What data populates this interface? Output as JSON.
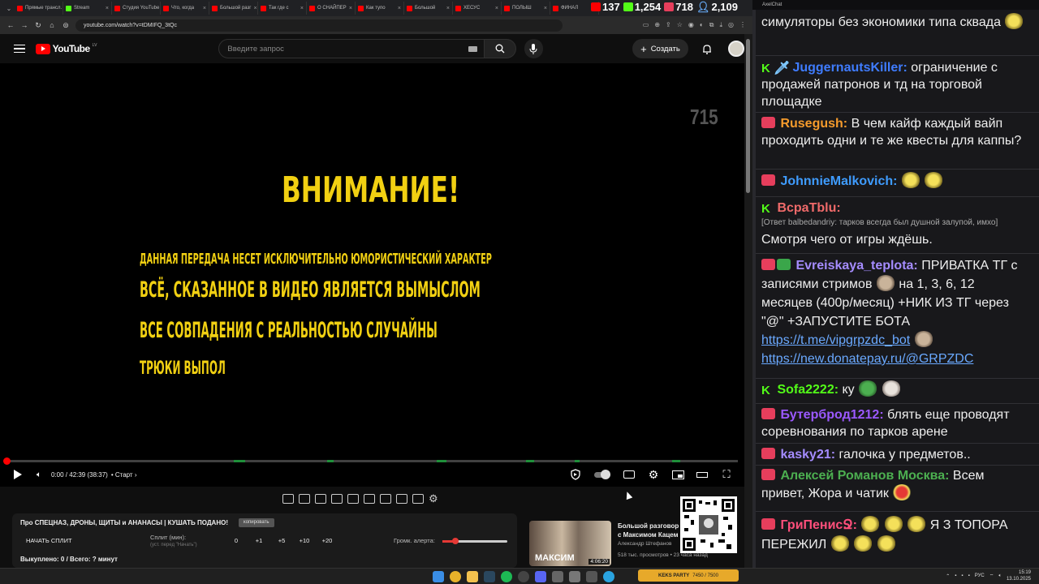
{
  "browser": {
    "tabs": [
      {
        "label": "Прямые трансл.",
        "color": "#ff0000"
      },
      {
        "label": "Stream",
        "color": "#53fc18"
      },
      {
        "label": "Студия YouTube",
        "color": "#ff0000"
      },
      {
        "label": "Что, когда",
        "color": "#ff0000"
      },
      {
        "label": "Большой разг",
        "color": "#ff0000"
      },
      {
        "label": "Так где с",
        "color": "#ff0000"
      },
      {
        "label": "О СНАЙПЕР",
        "color": "#ff0000"
      },
      {
        "label": "Как тупо",
        "color": "#ff0000"
      },
      {
        "label": "Большой",
        "color": "#ff0000"
      },
      {
        "label": "ХЕСУС",
        "color": "#ff0000"
      },
      {
        "label": "ПОЛЫШ",
        "color": "#ff0000"
      },
      {
        "label": "ФИНАЛ",
        "color": "#ff0000"
      }
    ],
    "url": "youtube.com/watch?v=tDMIFQ_3tQc"
  },
  "youtube": {
    "logo_text": "YouTube",
    "logo_country": "LV",
    "search_placeholder": "Введите запрос",
    "create_label": "Создать"
  },
  "video": {
    "counter": "715",
    "title_text": "ВНИМАНИЕ!",
    "line1": "ДАННАЯ ПЕРЕДАЧА НЕСЕТ ИСКЛЮЧИТЕЛЬНО ЮМОРИСТИЧЕСКИЙ ХАРАКТЕР",
    "line2": "ВСЁ, СКАЗАННОЕ В ВИДЕО ЯВЛЯЕТСЯ ВЫМЫСЛОМ",
    "line3": "ВСЕ СОВПАДЕНИЯ С РЕАЛЬНОСТЬЮ СЛУЧАЙНЫ",
    "line4": "ТРЮКИ ВЫПОЛ",
    "time": "0:00 / 42:39 (38:37)",
    "chapter": "• Старт ›",
    "progress": 0.0
  },
  "panel": {
    "video_title": "Про СПЕЦНАЗ, ДРОНЫ, ЩИТЫ и АНАНАСЫ | КУШАТЬ ПОДАНО!",
    "copy_label": "копировать",
    "split_button": "НАЧАТЬ СПЛИТ",
    "split_label": "Сплит (мин):",
    "split_hint": "(уст. перед \"Начать\")",
    "split_values": [
      "0",
      "+1",
      "+5",
      "+10",
      "+20"
    ],
    "alert_label": "Громк. алерта:",
    "alert_volume": 0.2,
    "bought": "Выкуплено: 0 / Всего: ? минут"
  },
  "recommendation": {
    "title": "Большой разговор с Максимом Кацем",
    "thumb_text": "МАКСИМ",
    "duration": "4:06:20",
    "channel": "Александр Штефанов",
    "meta": "518 тыс. просмотров • 23 часа назад"
  },
  "stats": {
    "youtube": "137",
    "kick": "1,254",
    "live": "718",
    "total": "2,109"
  },
  "chat": {
    "window_title": "AxelChat",
    "messages": [
      {
        "text": "симуляторы без экономики типа сквада"
      },
      {
        "user": "JuggernautsKiller:",
        "user_color": "#3f7cff",
        "text": "ограничение с продажей патронов и тд на торговой площадке"
      },
      {
        "user": "Rusegush:",
        "user_color": "#f59b2c",
        "text": "В чем кайф каждый вайп проходить одни и те же квесты для каппы?"
      },
      {
        "user": "JohnnieMalkovich:",
        "user_color": "#3f9cff",
        "text": ""
      },
      {
        "user": "BcpaTblu:",
        "user_color": "#f06a6a",
        "reply": "[Ответ balbedandriy: тарков всегда был душной залупой, имхо]",
        "text": "Смотря чего от игры ждёшь."
      },
      {
        "user": "Evreiskaya_teplota:",
        "user_color": "#a58cff",
        "text": "ПРИВАТКА ТГ с записями стримов",
        "text2": "на 1, 3, 6, 12 месяцев (400р/месяц) +НИК ИЗ ТГ через \"@\" +ЗАПУСТИТЕ БОТА",
        "link1": "https://t.me/vipgrpzdc_bot",
        "link2": "https://new.donatepay.ru/@GRPZDC"
      },
      {
        "user": "Sofa2222:",
        "user_color": "#53fc18",
        "text": "ку"
      },
      {
        "user": "Бутерброд1212:",
        "user_color": "#9b59ff",
        "text": "блять еще проводят соревнования по тарков арене"
      },
      {
        "user": "kasky21:",
        "user_color": "#a58cff",
        "text": "галочка у предметов.."
      },
      {
        "user": "Алексей Романов Москва:",
        "user_color": "#4caf50",
        "text": "Всем привет, Жора и чатик"
      },
      {
        "user": "ГриПенисՋ:",
        "user_color": "#ff4f7b",
        "text": "Я З ТОПОРА",
        "text2": "ПЕРЕЖИЛ"
      }
    ]
  },
  "taskbar": {
    "app_label": "KEKS PARTY",
    "app_progress": "7450 / 7500",
    "lang": "РУС",
    "time": "15:19",
    "date": "13.10.2025"
  }
}
